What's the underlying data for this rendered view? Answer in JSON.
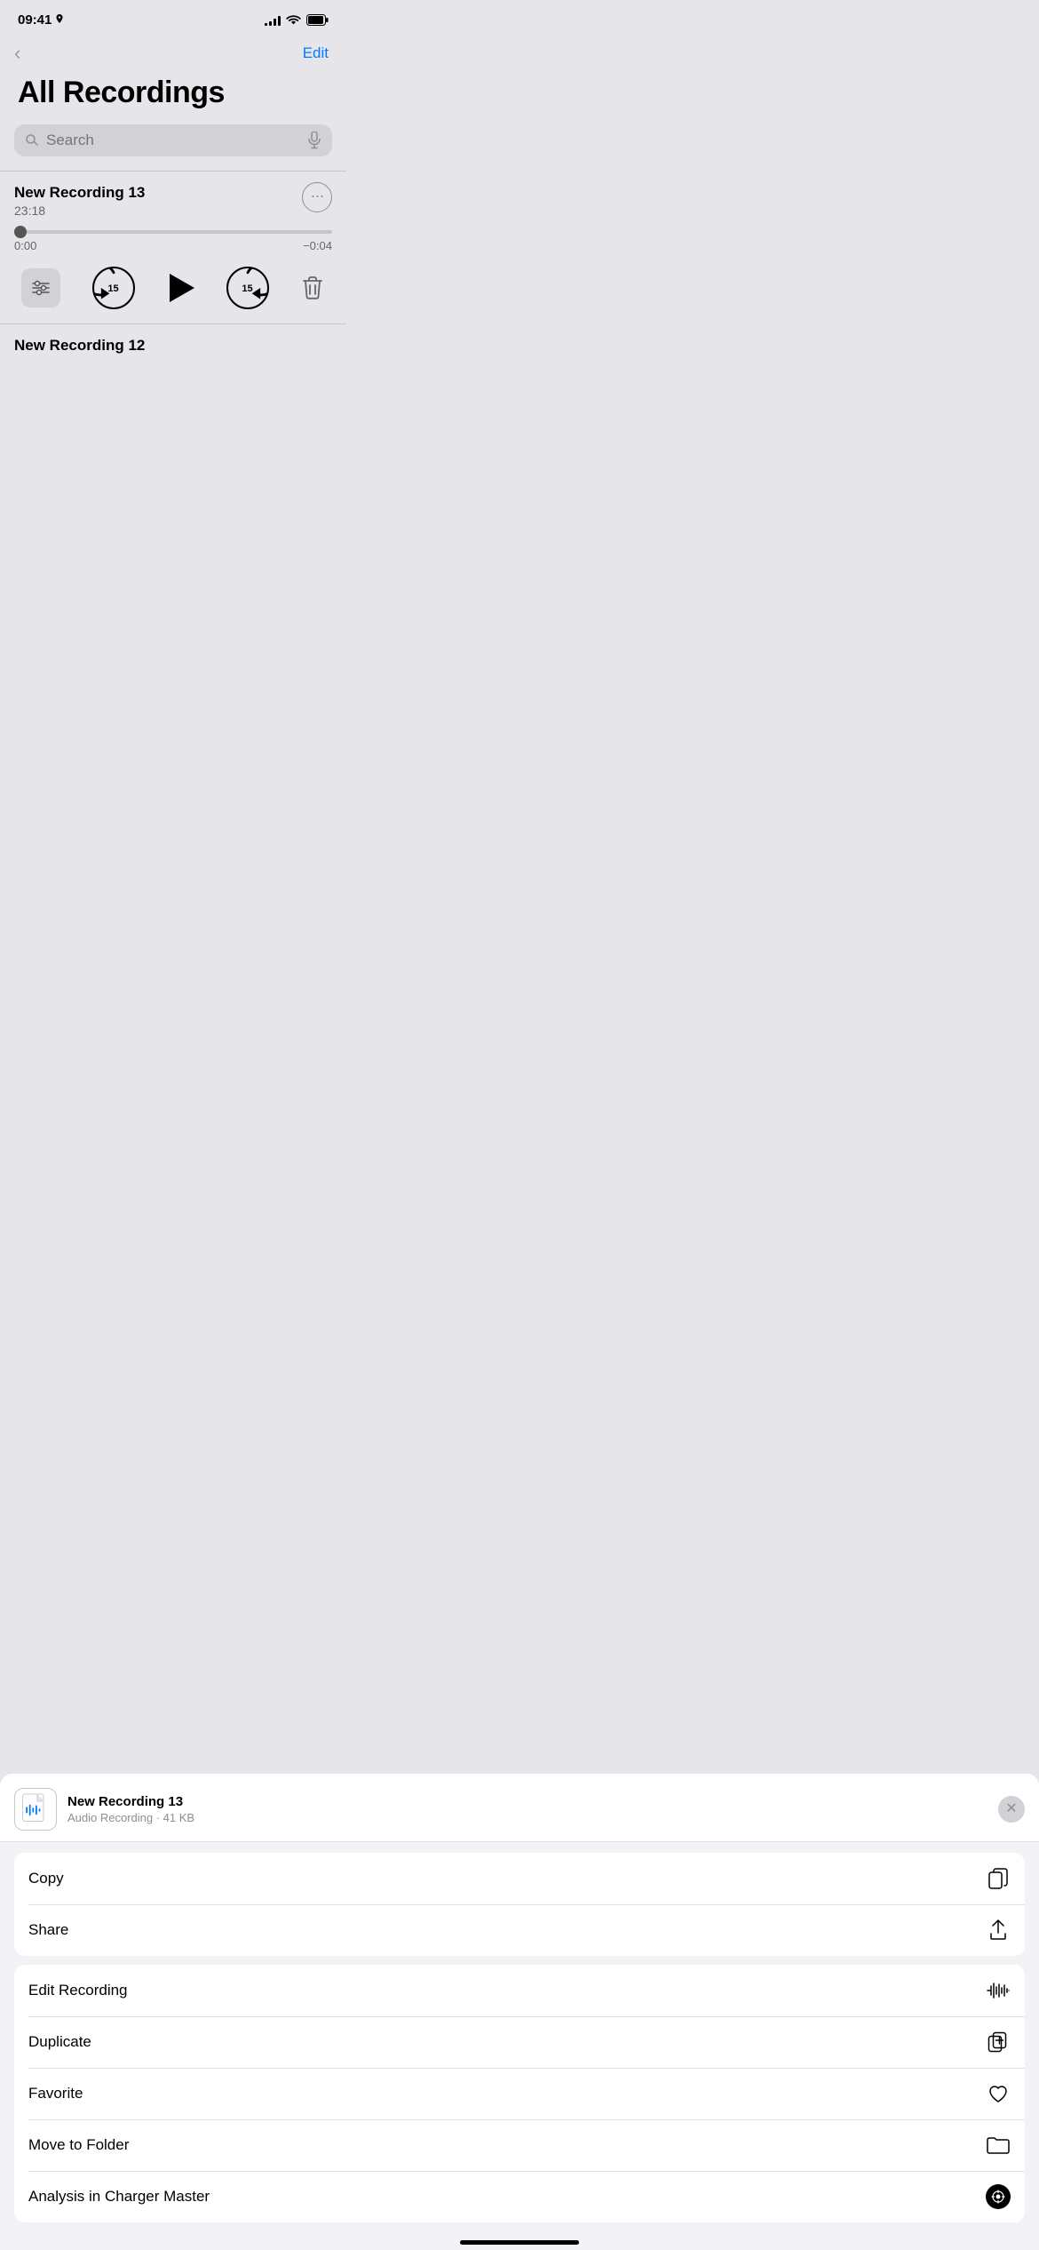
{
  "statusBar": {
    "time": "09:41",
    "locationIcon": "▶",
    "signalBars": [
      3,
      5,
      7,
      9,
      11
    ],
    "wifiIcon": "wifi",
    "batteryIcon": "battery"
  },
  "nav": {
    "backLabel": "‹",
    "editLabel": "Edit"
  },
  "page": {
    "title": "All Recordings"
  },
  "search": {
    "placeholder": "Search"
  },
  "recording": {
    "title": "New Recording 13",
    "duration": "23:18",
    "currentTime": "0:00",
    "remainingTime": "−0:04",
    "progressPercent": 2
  },
  "controls": {
    "skipBack15": "15",
    "skipForward15": "15"
  },
  "nextRecording": {
    "title": "New Recording 12"
  },
  "sheet": {
    "title": "New Recording 13",
    "subtitle": "Audio Recording · 41 KB",
    "closeLabel": "✕"
  },
  "actions": {
    "group1": [
      {
        "label": "Copy",
        "icon": "copy"
      },
      {
        "label": "Share",
        "icon": "share"
      }
    ],
    "group2": [
      {
        "label": "Edit Recording",
        "icon": "waveform"
      },
      {
        "label": "Duplicate",
        "icon": "duplicate"
      },
      {
        "label": "Favorite",
        "icon": "heart"
      },
      {
        "label": "Move to Folder",
        "icon": "folder"
      },
      {
        "label": "Analysis in Charger Master",
        "icon": "charger"
      }
    ]
  },
  "homeIndicator": {}
}
